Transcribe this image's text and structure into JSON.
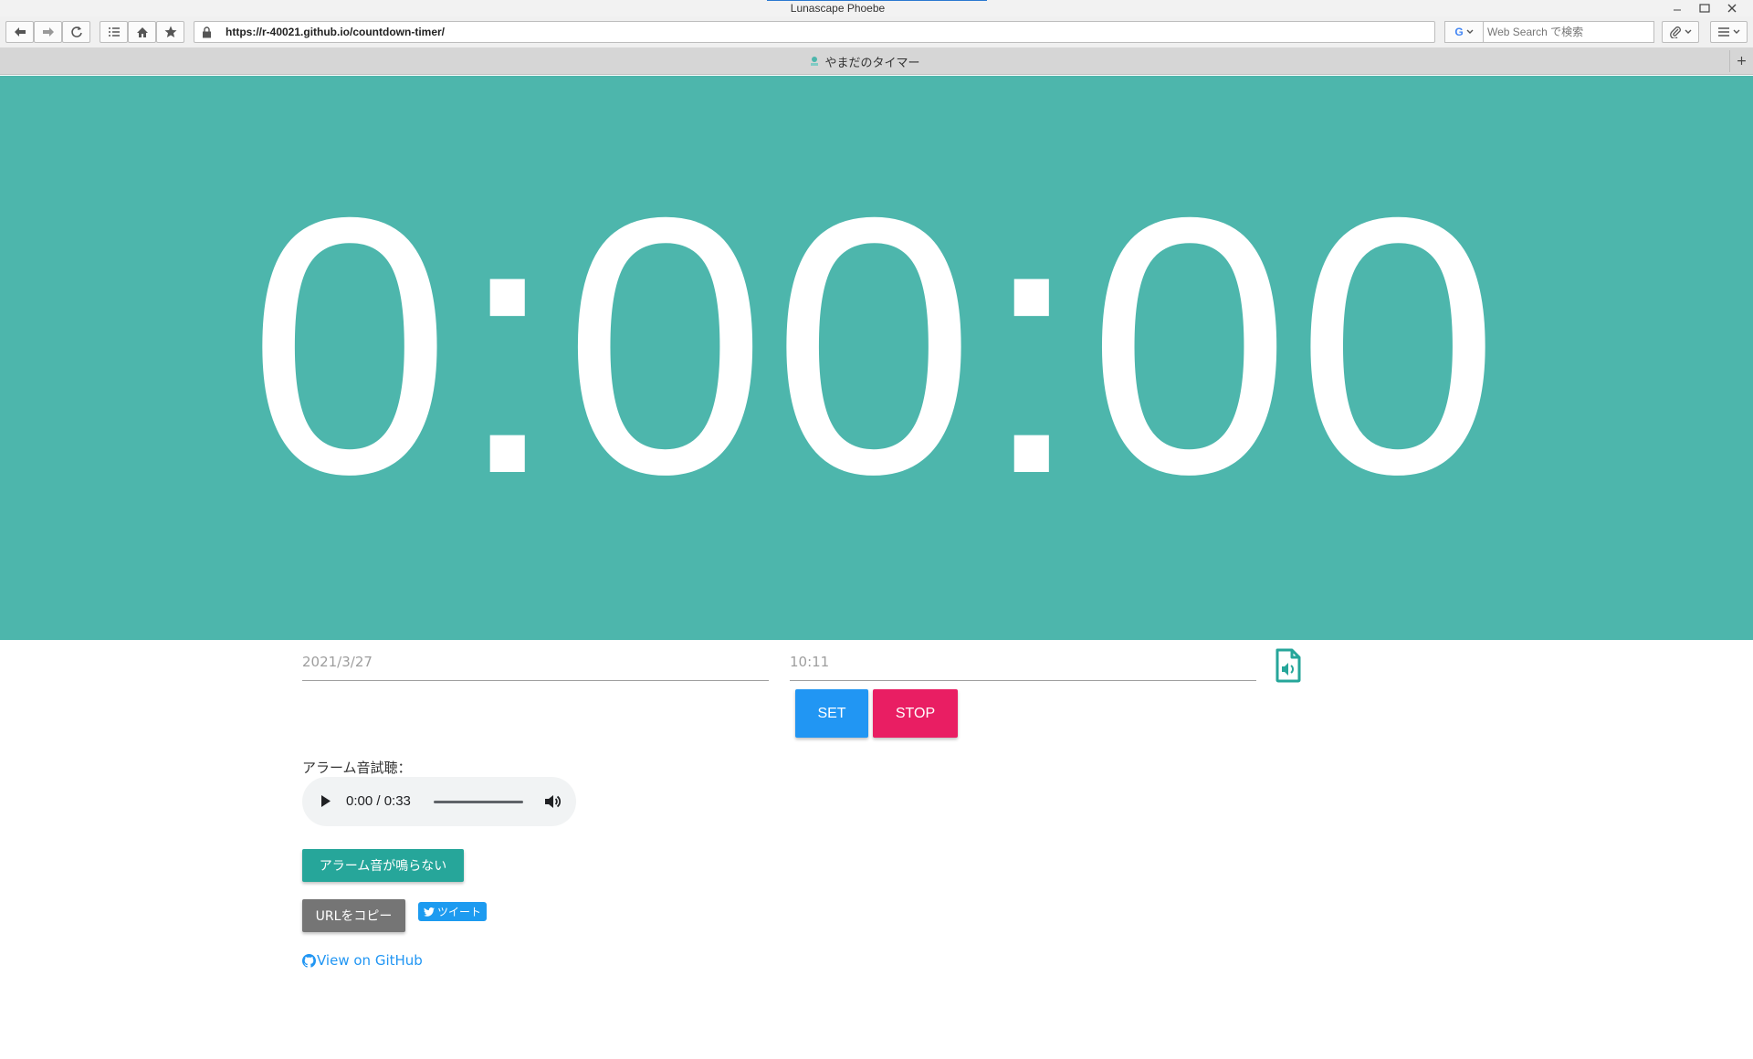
{
  "window": {
    "title": "Lunascape Phoebe",
    "accent_color": "#2b79d0"
  },
  "toolbar": {
    "url": "https://r-40021.github.io/countdown-timer/",
    "search_placeholder": "Web Search で検索",
    "search_engine_icon": "google-icon"
  },
  "tab": {
    "title": "やまだのタイマー",
    "new_tab_label": "+"
  },
  "timer": {
    "display": "0:00:00",
    "background_color": "#4db6ac",
    "text_color": "#ffffff"
  },
  "form": {
    "date_value": "2021/3/27",
    "time_value": "10:11",
    "set_label": "SET",
    "stop_label": "STOP",
    "set_color": "#2196f3",
    "stop_color": "#e91e63"
  },
  "alarm": {
    "label": "アラーム音試聴：",
    "audio_time": "0:00 / 0:33",
    "not_ringing_label": "アラーム音が鳴らない",
    "not_ringing_color": "#26a69a"
  },
  "share": {
    "copy_url_label": "URLをコピー",
    "copy_color": "#757575",
    "tweet_label": "ツイート",
    "tweet_color": "#1d9bf0",
    "github_label": "View on GitHub",
    "link_color": "#2196f3"
  }
}
